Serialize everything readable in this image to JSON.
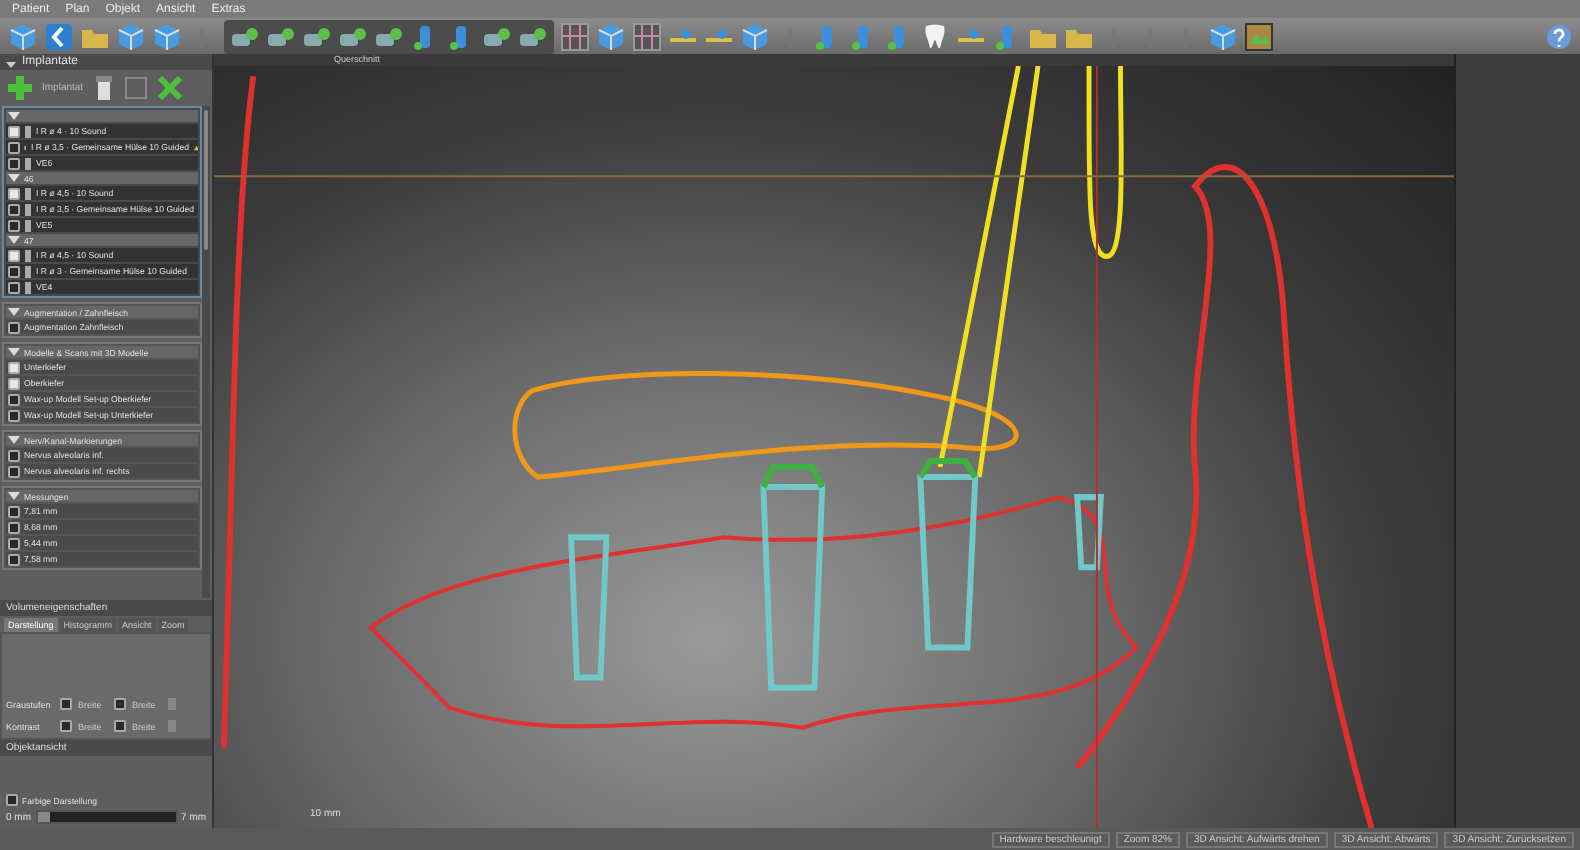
{
  "menu": [
    "Patient",
    "Plan",
    "Objekt",
    "Ansicht",
    "Extras"
  ],
  "panel": {
    "title": "Implantate",
    "add_label": "Implantat",
    "groups": [
      {
        "expanded": true,
        "rows": [
          {
            "text": "I R ø 4 · 10 Sound",
            "checked": true,
            "warning": false
          },
          {
            "text": "I R ø 3,5 · Gemeinsame Hülse 10 Guided",
            "checked": false,
            "warning": true
          },
          {
            "text": "VE6",
            "checked": false,
            "warning": false
          }
        ]
      },
      {
        "label": "46",
        "expanded": true,
        "rows": [
          {
            "text": "I R ø 4,5 · 10 Sound",
            "checked": true,
            "warning": false
          },
          {
            "text": "I R ø 3,5 · Gemeinsame Hülse 10 Guided",
            "checked": false,
            "warning": false
          },
          {
            "text": "VE5",
            "checked": false,
            "warning": false
          }
        ]
      },
      {
        "label": "47",
        "expanded": true,
        "rows": [
          {
            "text": "I R ø 4,5 · 10 Sound",
            "checked": true,
            "warning": false
          },
          {
            "text": "I R ø 3 · Gemeinsame Hülse 10 Guided",
            "checked": false,
            "warning": false
          },
          {
            "text": "VE4",
            "checked": false,
            "warning": false
          }
        ]
      }
    ],
    "sections": [
      {
        "title": "Augmentation / Zahnfleisch",
        "expanded": true,
        "rows": [
          {
            "text": "Augmentation Zahnfleisch",
            "checked": false
          }
        ]
      },
      {
        "title": "Modelle & Scans mit 3D Modelle",
        "expanded": true,
        "rows": [
          {
            "text": "Unterkiefer",
            "checked": true
          },
          {
            "text": "Oberkiefer",
            "checked": true
          },
          {
            "text": "Wax-up Modell Set-up Oberkiefer",
            "checked": false
          },
          {
            "text": "Wax-up Modell Set-up Unterkiefer",
            "checked": false
          }
        ]
      },
      {
        "title": "Nerv/Kanal-Markierungen",
        "expanded": true,
        "rows": [
          {
            "text": "Nervus alveolaris inf.",
            "checked": false
          },
          {
            "text": "Nervus alveolaris inf. rechts",
            "checked": false
          }
        ]
      },
      {
        "title": "Messungen",
        "expanded": true,
        "rows": [
          {
            "text": "7,81 mm",
            "checked": false
          },
          {
            "text": "8,68 mm",
            "checked": false
          },
          {
            "text": "5,44 mm",
            "checked": false
          },
          {
            "text": "7,58 mm",
            "checked": false
          }
        ]
      }
    ],
    "properties_title": "Volumeneigenschaften",
    "tabs": [
      {
        "label": "Darstellung",
        "selected": true
      },
      {
        "label": "Histogramm",
        "selected": false
      },
      {
        "label": "Ansicht",
        "selected": false
      },
      {
        "label": "Zoom",
        "selected": false
      }
    ],
    "settings": [
      {
        "label": "Graustufen",
        "options": [
          {
            "text": "Breite",
            "checked": false
          },
          {
            "text": "Breite",
            "checked": false
          }
        ]
      },
      {
        "label": "Kontrast",
        "options": [
          {
            "text": "Breite",
            "checked": false
          },
          {
            "text": "Breite",
            "checked": false
          }
        ]
      }
    ],
    "object_view": "Objektansicht",
    "color_checkbox": {
      "label": "Farbige Darstellung",
      "checked": false
    },
    "slider": {
      "min": "0 mm",
      "max": "7 mm",
      "level": 0.1
    }
  },
  "view": {
    "title": "Querschnitt",
    "scale": "10 mm"
  },
  "status_bar": [
    "Hardware beschleunigt",
    "Zoom 82%",
    "3D Ansicht: Aufwärts drehen",
    "3D Ansicht: Abwärts",
    "3D Ansicht: Zurücksetzen"
  ]
}
